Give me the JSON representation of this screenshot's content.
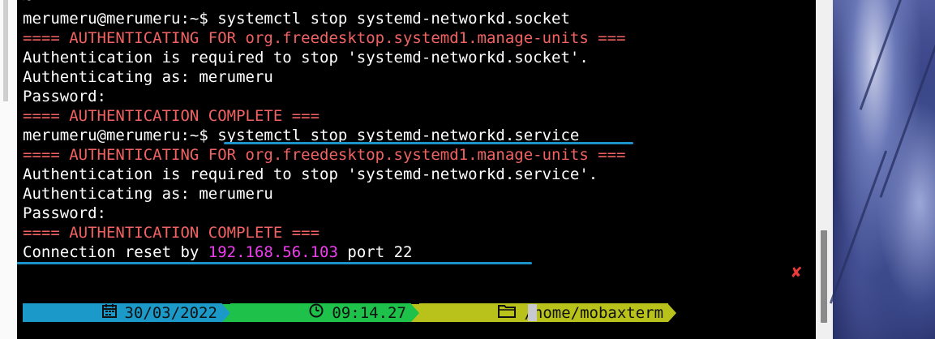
{
  "terminal": {
    "lines": [
      [
        {
          "t": "~",
          "c": "white"
        }
      ],
      [
        {
          "t": "merumeru@merumeru:~$ systemctl stop systemd-networkd.socket",
          "c": "white"
        }
      ],
      [
        {
          "t": "==== AUTHENTICATING FOR org.freedesktop.systemd1.manage-units ===",
          "c": "red"
        }
      ],
      [
        {
          "t": "Authentication is required to stop 'systemd-networkd.socket'.",
          "c": "white"
        }
      ],
      [
        {
          "t": "Authenticating as: merumeru",
          "c": "white"
        }
      ],
      [
        {
          "t": "Password:",
          "c": "white"
        }
      ],
      [
        {
          "t": "==== AUTHENTICATION COMPLETE ===",
          "c": "red"
        }
      ],
      [
        {
          "t": "merumeru@merumeru:~$ systemctl stop systemd-networkd.service",
          "c": "white"
        }
      ],
      [
        {
          "t": "==== AUTHENTICATING FOR org.freedesktop.systemd1.manage-units ===",
          "c": "red"
        }
      ],
      [
        {
          "t": "Authentication is required to stop 'systemd-networkd.service'.",
          "c": "white"
        }
      ],
      [
        {
          "t": "Authenticating as: merumeru",
          "c": "white"
        }
      ],
      [
        {
          "t": "Password:",
          "c": "white"
        }
      ],
      [
        {
          "t": "==== AUTHENTICATION COMPLETE ===",
          "c": "red"
        }
      ],
      [
        {
          "t": "Connection reset by ",
          "c": "white"
        },
        {
          "t": "192.168.56.103",
          "c": "magenta"
        },
        {
          "t": " port 22",
          "c": "white"
        }
      ]
    ],
    "close_symbol": "✘"
  },
  "prompt": {
    "date_icon": "calendar-icon",
    "date": "30/03/2022",
    "time_icon": "clock-icon",
    "time": "09:14.27",
    "folder_icon": "folder-icon",
    "path": "/home/mobaxterm"
  },
  "colors": {
    "date_segment": "#1b9ac9",
    "time_segment": "#1ec14a",
    "path_segment": "#b8c21a",
    "error_text": "#f26262",
    "ip_text": "#f03cf0",
    "annotation_underline": "#1b93c8"
  }
}
